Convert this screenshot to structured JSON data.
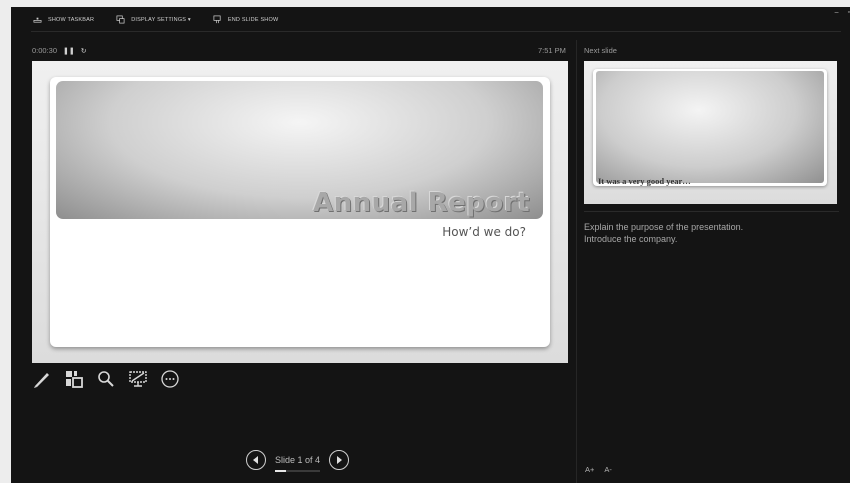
{
  "toolbar": {
    "show_taskbar": "SHOW TASKBAR",
    "display_settings": "DISPLAY SETTINGS ▾",
    "end_slide_show": "END SLIDE SHOW"
  },
  "window_controls": {
    "minimize": "–",
    "restore": "▫"
  },
  "status": {
    "elapsed": "0:00:30",
    "clock": "7:51 PM"
  },
  "current_slide": {
    "title": "Annual Report",
    "subtitle": "How’d we do?"
  },
  "tools": [
    "pen-tool-icon",
    "see-all-slides-icon",
    "zoom-icon",
    "black-screen-icon",
    "more-options-icon"
  ],
  "navigation": {
    "slide_indicator": "Slide 1 of 4",
    "progress": 0.25
  },
  "next_slide": {
    "label": "Next slide",
    "text": "It was a very good year…"
  },
  "notes": {
    "line1": "Explain the purpose of the presentation.",
    "line2": "Introduce the company."
  },
  "font_controls": {
    "increase": "A+",
    "decrease": "A-"
  },
  "colors": {
    "background": "#141414",
    "page": "#ededed",
    "text": "#a7a7a7"
  }
}
